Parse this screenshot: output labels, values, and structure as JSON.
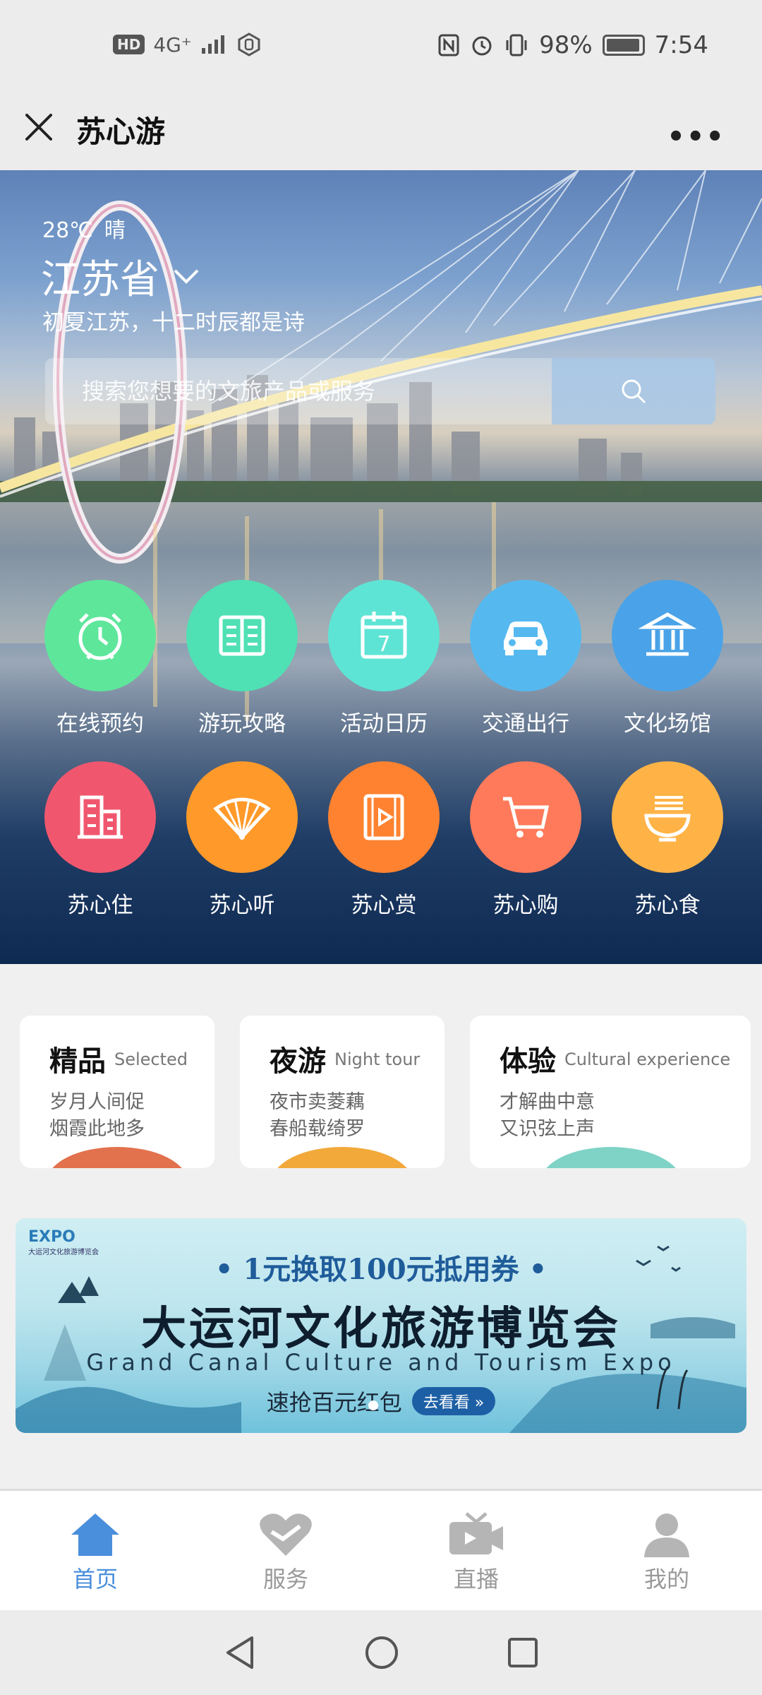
{
  "status_bar": {
    "left_badge": "HD",
    "signal": "4G⁺",
    "battery_percent": "98%",
    "time": "7:54"
  },
  "title_bar": {
    "title": "苏心游",
    "more": "•••"
  },
  "hero": {
    "temperature": "28℃",
    "weather": "晴",
    "province": "江苏省",
    "slogan": "初夏江苏，十二时辰都是诗",
    "search_placeholder": "搜索您想要的文旅产品或服务",
    "icons_row1": [
      {
        "label": "在线预约",
        "icon": "alarm-clock-icon",
        "color": "#5ee69b"
      },
      {
        "label": "游玩攻略",
        "icon": "book-icon",
        "color": "#4fe0b4"
      },
      {
        "label": "活动日历",
        "icon": "calendar-icon",
        "color": "#5ee4d4"
      },
      {
        "label": "交通出行",
        "icon": "car-icon",
        "color": "#55b9f0"
      },
      {
        "label": "文化场馆",
        "icon": "museum-icon",
        "color": "#4aa3e8"
      }
    ],
    "icons_row2": [
      {
        "label": "苏心住",
        "icon": "building-icon",
        "color": "#f0576e"
      },
      {
        "label": "苏心听",
        "icon": "fan-icon",
        "color": "#ff9a2a"
      },
      {
        "label": "苏心赏",
        "icon": "video-icon",
        "color": "#ff8230"
      },
      {
        "label": "苏心购",
        "icon": "cart-icon",
        "color": "#ff7a5a"
      },
      {
        "label": "苏心食",
        "icon": "noodle-bowl-icon",
        "color": "#ffb347"
      }
    ],
    "calendar_day": "7"
  },
  "categories": [
    {
      "title": "精品",
      "subtitle": "Selected",
      "line1": "岁月人间促",
      "line2": "烟霞此地多",
      "blob_color": "#e2714d"
    },
    {
      "title": "夜游",
      "subtitle": "Night tour",
      "line1": "夜市卖菱藕",
      "line2": "春船载绮罗",
      "blob_color": "#f2a93a"
    },
    {
      "title": "体验",
      "subtitle": "Cultural experience",
      "line1": "才解曲中意",
      "line2": "又识弦上声",
      "blob_color": "#7fd3c6"
    }
  ],
  "banner": {
    "logo": "EXPO",
    "logo_sub": "大运河文化旅游博览会",
    "promo": "• 1元换取100元抵用券 •",
    "title": "大运河文化旅游博览会",
    "title_en": "Grand Canal Culture and Tourism Expo",
    "cta_text": "速抢百元红包",
    "cta_button": "去看看 »"
  },
  "bottom_nav": [
    {
      "label": "首页",
      "icon": "home-icon",
      "active": true
    },
    {
      "label": "服务",
      "icon": "heart-icon",
      "active": false
    },
    {
      "label": "直播",
      "icon": "tv-icon",
      "active": false
    },
    {
      "label": "我的",
      "icon": "person-icon",
      "active": false
    }
  ],
  "colors": {
    "accent": "#4a8fdc",
    "inactive": "#b5b5b5"
  }
}
